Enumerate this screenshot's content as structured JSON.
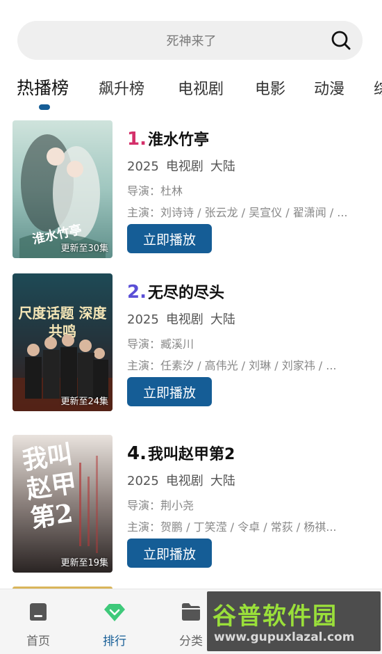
{
  "search": {
    "placeholder": "死神来了"
  },
  "tabs": [
    {
      "label": "热播榜",
      "active": true
    },
    {
      "label": "飙升榜"
    },
    {
      "label": "电视剧"
    },
    {
      "label": "电影"
    },
    {
      "label": "动漫"
    },
    {
      "label": "综"
    }
  ],
  "items": [
    {
      "rank": "1.",
      "rank_color": "#d4306a",
      "title": "淮水竹亭",
      "year": "2025",
      "genre": "电视剧",
      "region": "大陆",
      "director": "导演：杜林",
      "actors": "主演：刘诗诗 / 张云龙 / 吴宣仪 / 翟潇闻 / ...",
      "update": "更新至30集",
      "poster_text": "淮水竹亭",
      "play_label": "立即播放"
    },
    {
      "rank": "2.",
      "rank_color": "#5a4fd6",
      "title": "无尽的尽头",
      "year": "2025",
      "genre": "电视剧",
      "region": "大陆",
      "director": "导演：臧溪川",
      "actors": "主演：任素汐 / 高伟光 / 刘琳 / 刘家祎 / ...",
      "update": "更新至24集",
      "poster_text": "尺度话题 深度共鸣",
      "play_label": "立即播放"
    },
    {
      "rank": "4.",
      "rank_color": "#111111",
      "title": "我叫赵甲第2",
      "year": "2025",
      "genre": "电视剧",
      "region": "大陆",
      "director": "导演：荆小尧",
      "actors": "主演：贺鹏 / 丁笑滢 / 令卓 / 常荻 / 杨祺...",
      "update": "更新至19集",
      "poster_text": "我叫赵甲第2",
      "play_label": "立即播放"
    }
  ],
  "nav": [
    {
      "label": "首页",
      "icon": "home-icon"
    },
    {
      "label": "排行",
      "icon": "ranking-icon",
      "active": true
    },
    {
      "label": "分类",
      "icon": "folder-icon"
    }
  ],
  "watermark": {
    "text": "谷普软件园",
    "url": "www.gupuxlazal.com"
  },
  "colors": {
    "accent": "#155d96",
    "ranking_icon": "#3ec97a"
  }
}
